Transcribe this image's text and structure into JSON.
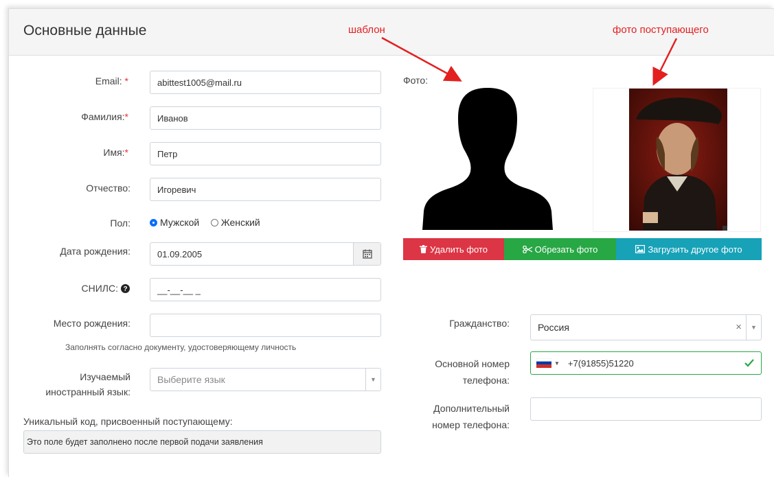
{
  "header": {
    "title": "Основные данные"
  },
  "annotations": {
    "template": "шаблон",
    "applicant_photo": "фото поступающего"
  },
  "colors": {
    "required": "#e3342f",
    "delete": "#dc3545",
    "crop": "#28a745",
    "upload": "#17a2b8",
    "annotation": "#e32020",
    "valid": "#28a745"
  },
  "form": {
    "email": {
      "label": "Email:",
      "required_mark": "*",
      "value": "abittest1005@mail.ru"
    },
    "last_name": {
      "label": "Фамилия:",
      "required_mark": "*",
      "value": "Иванов"
    },
    "first_name": {
      "label": "Имя:",
      "required_mark": "*",
      "value": "Петр"
    },
    "patronymic": {
      "label": "Отчество:",
      "value": "Игоревич"
    },
    "gender": {
      "label": "Пол:",
      "options": [
        "Мужской",
        "Женский"
      ],
      "selected": "Мужской"
    },
    "birth_date": {
      "label": "Дата рождения:",
      "value": "01.09.2005",
      "icon": "calendar-icon"
    },
    "snils": {
      "label": "СНИЛС:",
      "value": "__-__-__ _",
      "icon": "question-circle-icon"
    },
    "birth_place": {
      "label": "Место рождения:",
      "value": "",
      "hint": "Заполнять согласно документу, удостоверяющему личность"
    },
    "foreign_language": {
      "label_line1": "Изучаемый",
      "label_line2": "иностранный язык:",
      "placeholder": "Выберите язык"
    },
    "unique_code": {
      "label": "Уникальный код, присвоенный поступающему:",
      "value": "Это поле будет заполнено после первой подачи заявления"
    }
  },
  "photo": {
    "label": "Фото:",
    "buttons": {
      "delete": "Удалить фото",
      "crop": "Обрезать фото",
      "upload": "Загрузить другое фото"
    }
  },
  "right_form": {
    "citizenship": {
      "label": "Гражданство:",
      "value": "Россия",
      "clear": "×"
    },
    "main_phone": {
      "label_line1": "Основной номер",
      "label_line2": "телефона:",
      "value": "+7(91855)51220",
      "flag": "russia-flag-icon"
    },
    "extra_phone": {
      "label_line1": "Дополнительный",
      "label_line2": "номер телефона:",
      "value": ""
    }
  }
}
